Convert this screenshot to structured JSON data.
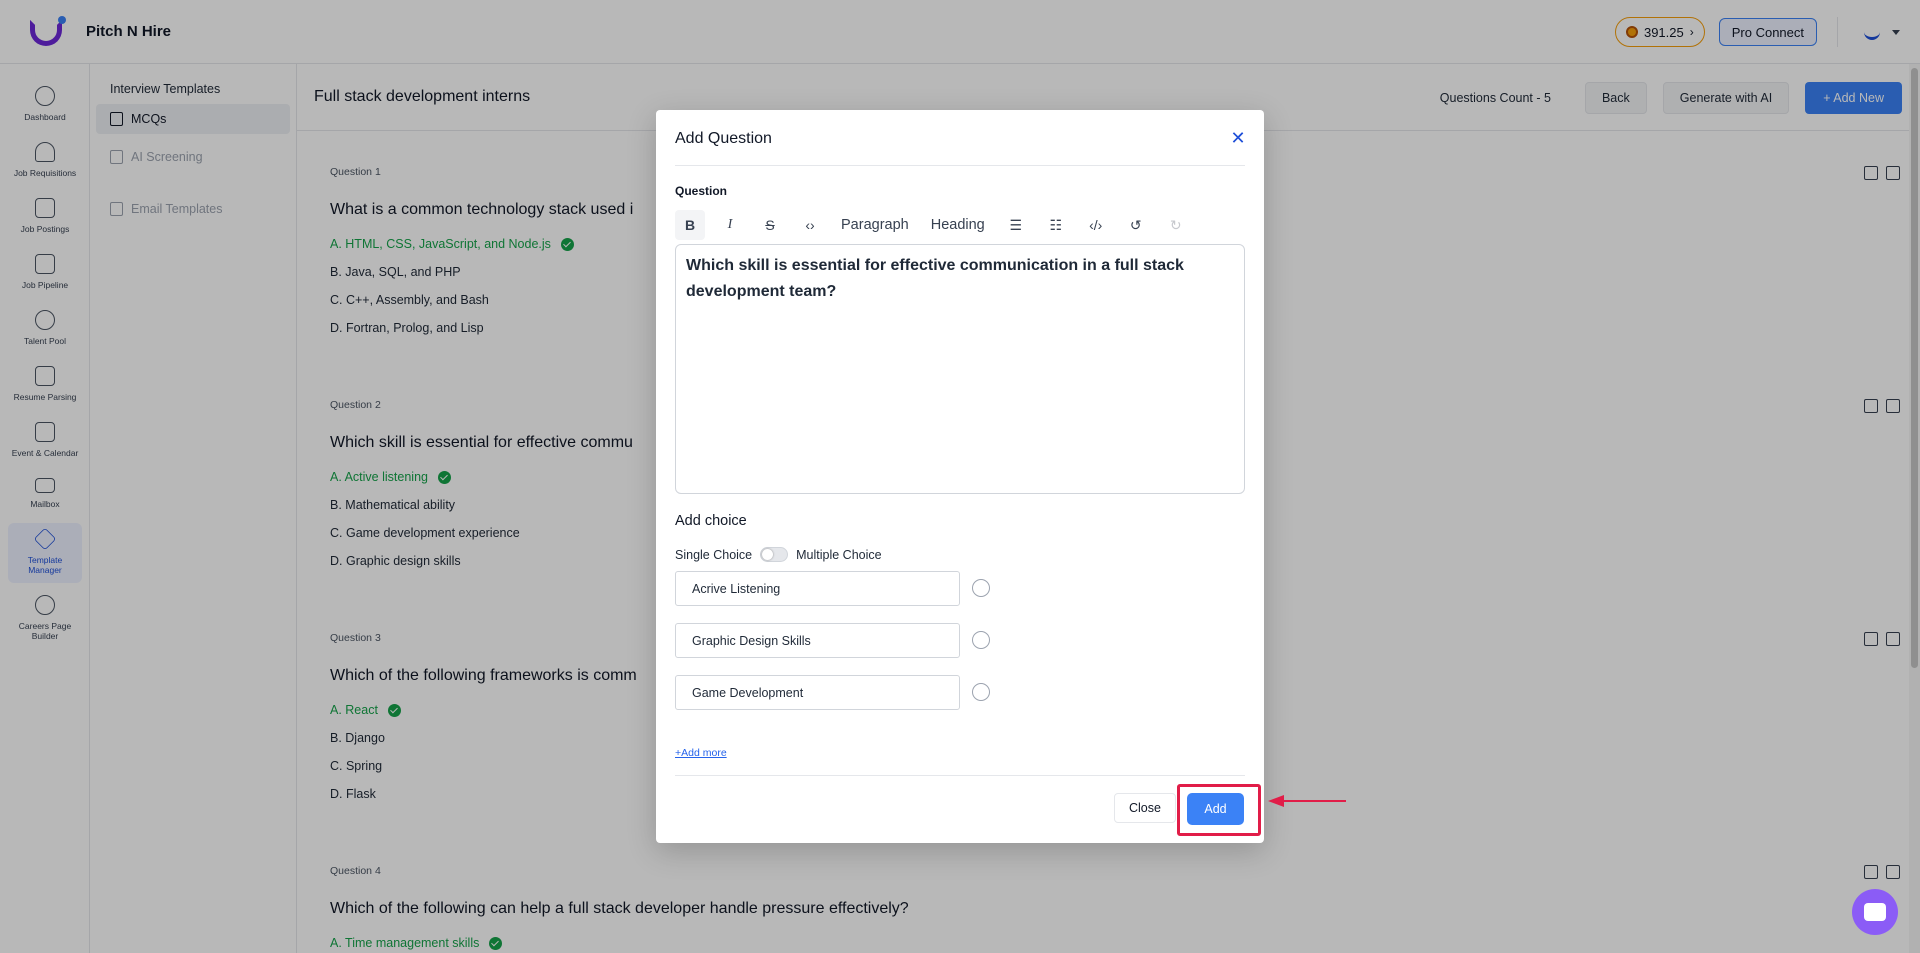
{
  "app": {
    "name": "Pitch N Hire"
  },
  "topbar": {
    "credits": "391.25",
    "pro_connect": "Pro Connect"
  },
  "rail": [
    {
      "label": "Dashboard",
      "icon": "dashboard-icon"
    },
    {
      "label": "Job Requisitions",
      "icon": "job-requisitions-icon"
    },
    {
      "label": "Job Postings",
      "icon": "briefcase-icon"
    },
    {
      "label": "Job Pipeline",
      "icon": "pipeline-icon"
    },
    {
      "label": "Talent Pool",
      "icon": "talent-pool-icon"
    },
    {
      "label": "Resume Parsing",
      "icon": "resume-icon"
    },
    {
      "label": "Event & Calendar",
      "icon": "calendar-icon"
    },
    {
      "label": "Mailbox",
      "icon": "mail-icon"
    },
    {
      "label": "Template Manager",
      "icon": "layers-icon"
    },
    {
      "label": "Careers Page Builder",
      "icon": "globe-icon"
    }
  ],
  "subnav": {
    "title": "Interview Templates",
    "items": [
      "MCQs",
      "AI Screening",
      "Email Templates"
    ]
  },
  "main": {
    "title": "Full stack development interns",
    "questions_count": "Questions Count - 5",
    "back": "Back",
    "generate": "Generate with AI",
    "add_new": "+ Add New"
  },
  "questions": [
    {
      "label": "Question 1",
      "text": "What is a common technology stack used i",
      "options": [
        "A. HTML, CSS, JavaScript, and Node.js",
        "B. Java, SQL, and PHP",
        "C. C++, Assembly, and Bash",
        "D. Fortran, Prolog, and Lisp"
      ]
    },
    {
      "label": "Question 2",
      "text": "Which skill is essential for effective commu",
      "options": [
        "A. Active listening",
        "B. Mathematical ability",
        "C. Game development experience",
        "D. Graphic design skills"
      ]
    },
    {
      "label": "Question 3",
      "text": "Which of the following frameworks is comm",
      "options": [
        "A. React",
        "B. Django",
        "C. Spring",
        "D. Flask"
      ]
    },
    {
      "label": "Question 4",
      "text": "Which of the following can help a full stack developer handle pressure effectively?",
      "options": [
        "A. Time management skills"
      ]
    }
  ],
  "modal": {
    "title": "Add Question",
    "question_label": "Question",
    "toolbar": {
      "paragraph": "Paragraph",
      "heading": "Heading"
    },
    "question_text": "Which skill is essential for effective communication in a full stack development team?",
    "add_choice": "Add choice",
    "single_choice": "Single Choice",
    "multiple_choice": "Multiple Choice",
    "choices": [
      "Acrive Listening",
      "Graphic Design Skills",
      "Game Development"
    ],
    "add_more": "+Add more",
    "close": "Close",
    "add": "Add"
  },
  "colors": {
    "primary": "#3b82f6",
    "correct": "#16a34a",
    "highlight": "#e11d48",
    "chat": "#8b5cf6"
  }
}
